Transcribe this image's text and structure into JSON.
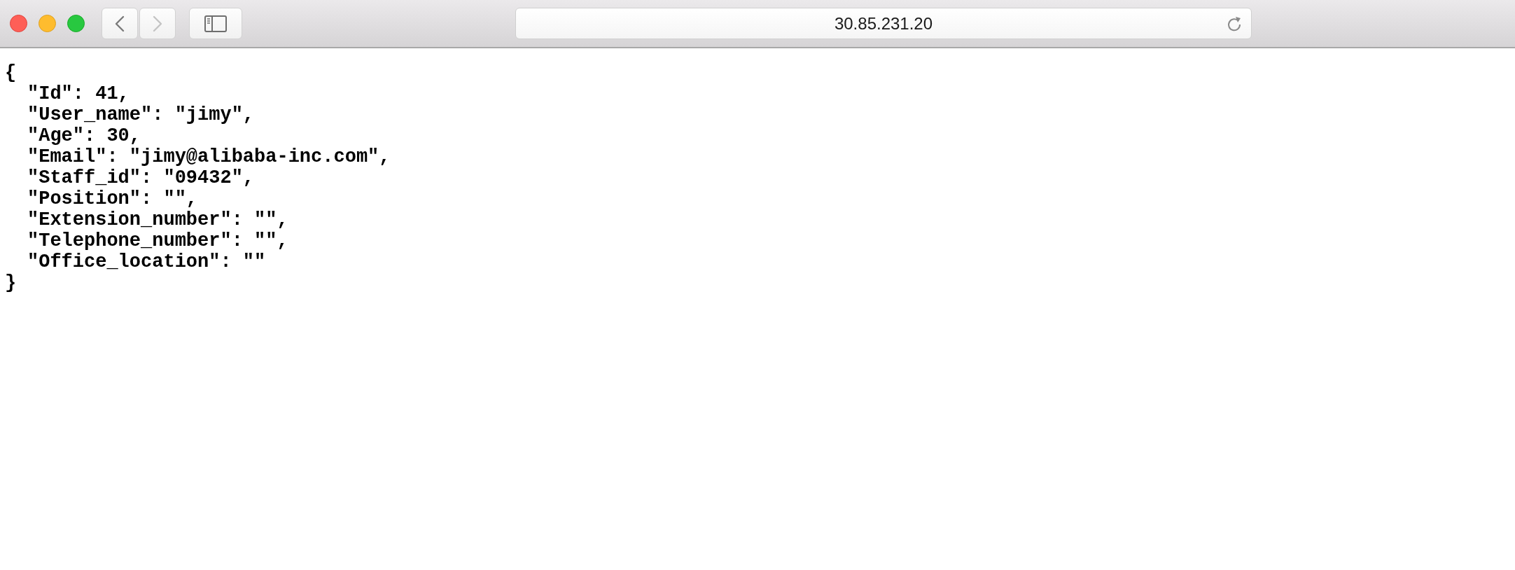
{
  "toolbar": {
    "back_button": {
      "disabled": false
    },
    "forward_button": {
      "disabled": true
    },
    "address": "30.85.231.20"
  },
  "document": {
    "open": "{",
    "lines": [
      "\"Id\": 41,",
      "\"User_name\": \"jimy\",",
      "\"Age\": 30,",
      "\"Email\": \"jimy@alibaba-inc.com\",",
      "\"Staff_id\": \"09432\",",
      "\"Position\": \"\",",
      "\"Extension_number\": \"\",",
      "\"Telephone_number\": \"\",",
      "\"Office_location\": \"\""
    ],
    "close": "}"
  }
}
